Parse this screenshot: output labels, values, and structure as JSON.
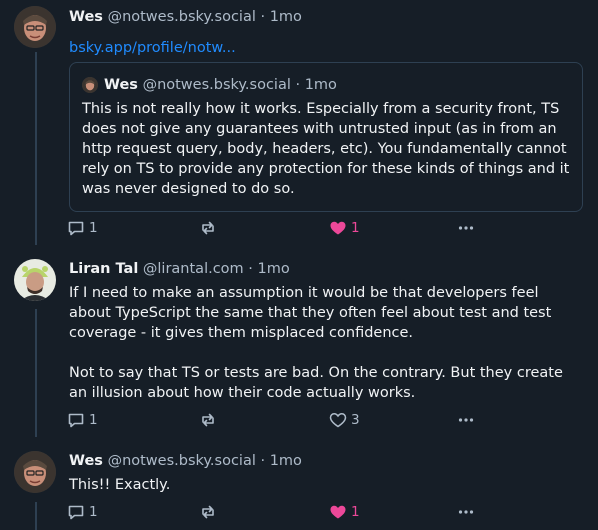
{
  "posts": [
    {
      "name": "Wes",
      "handle": "@notwes.bsky.social",
      "dot": "·",
      "time": "1mo",
      "link": "bsky.app/profile/notw...",
      "quote": {
        "name": "Wes",
        "handle": "@notwes.bsky.social",
        "dot": "·",
        "time": "1mo",
        "text": "This is not really how it works. Especially from a security front, TS does not give any guarantees with untrusted input (as in from an http request query, body, headers, etc). You fundamentally cannot rely on TS to provide any protection for these kinds of things and it was never designed to do so."
      },
      "replies": "1",
      "likes": "1",
      "liked": true
    },
    {
      "name": "Liran Tal",
      "handle": "@lirantal.com",
      "dot": "·",
      "time": "1mo",
      "text_p1": "If I need to make an assumption it would be that developers feel about TypeScript the same that they often feel about test and test coverage - it gives them misplaced confidence.",
      "text_p2": "Not to say that TS or tests are bad. On the contrary. But they create an illusion about how their code actually works.",
      "replies": "1",
      "likes": "3",
      "liked": false
    },
    {
      "name": "Wes",
      "handle": "@notwes.bsky.social",
      "dot": "·",
      "time": "1mo",
      "text": "This!! Exactly.",
      "replies": "1",
      "likes": "1",
      "liked": true
    }
  ],
  "colors": {
    "background": "#161e27",
    "text": "#f1f3f5",
    "muted": "#aebbc9",
    "link": "#208bfe",
    "like": "#ec4899",
    "border": "#2e4052"
  }
}
